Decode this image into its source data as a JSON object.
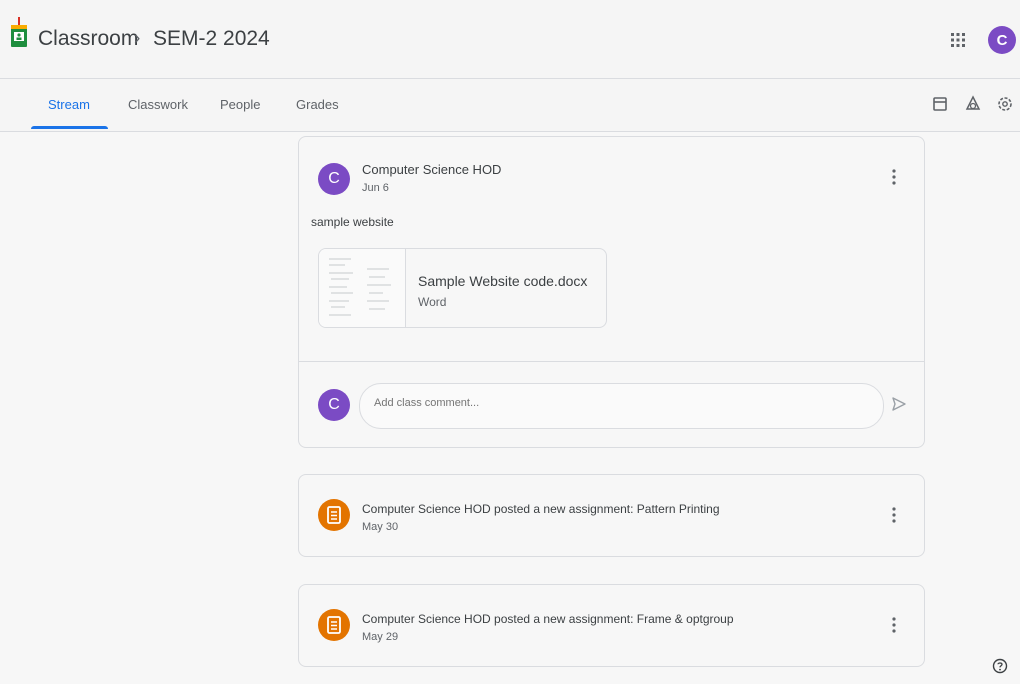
{
  "header": {
    "app_title": "Classroom",
    "separator": "›",
    "class_name": "SEM-2 2024",
    "user_initial": "C"
  },
  "tabs": [
    {
      "label": "Stream",
      "active": true
    },
    {
      "label": "Classwork",
      "active": false
    },
    {
      "label": "People",
      "active": false
    },
    {
      "label": "Grades",
      "active": false
    }
  ],
  "posts": [
    {
      "initial": "C",
      "author": "Computer Science HOD",
      "date": "Jun 6",
      "text": "sample website",
      "attachment": {
        "title": "Sample Website code.docx",
        "type": "Word"
      },
      "comment_initial": "C",
      "comment_placeholder": "Add class comment..."
    }
  ],
  "assignments": [
    {
      "title": "Computer Science HOD posted a new assignment: Pattern Printing",
      "date": "May 30"
    },
    {
      "title": "Computer Science HOD posted a new assignment: Frame & optgroup",
      "date": "May 29"
    }
  ],
  "colors": {
    "accent": "#1a73e8",
    "avatar": "#7b4bc4",
    "assignment": "#e37400"
  },
  "icons": [
    "classroom-logo-icon",
    "apps-grid-icon",
    "calendar-icon",
    "drive-folder-icon",
    "settings-icon",
    "more-vert-icon",
    "send-icon",
    "assignment-icon",
    "help-icon"
  ]
}
